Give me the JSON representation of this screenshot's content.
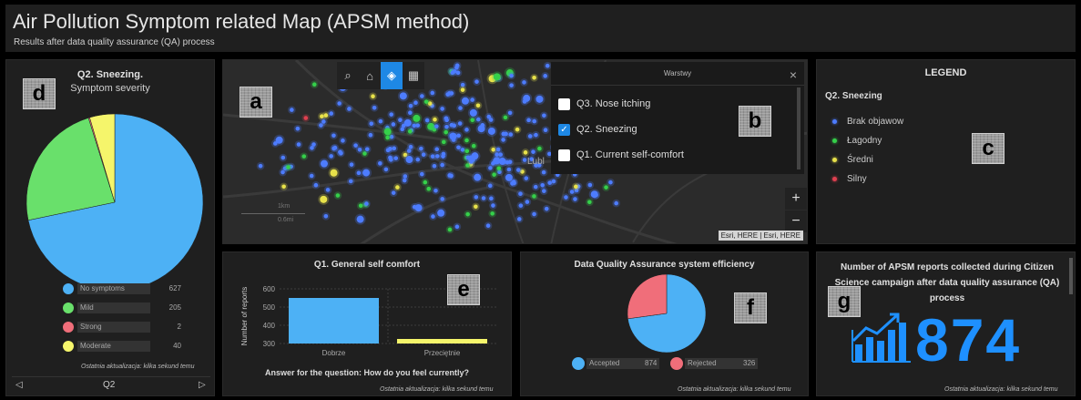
{
  "header": {
    "title": "Air Pollution Symptom related Map (APSM method)",
    "subtitle": "Results after data quality assurance (QA) process"
  },
  "tags": {
    "a": "a",
    "b": "b",
    "c": "c",
    "d": "d",
    "e": "e",
    "f": "f",
    "g": "g"
  },
  "updated_text": "Ostatnia aktualizacja: kilka sekund temu",
  "panel_d": {
    "title": "Q2. Sneezing.",
    "subtitle": "Symptom severity",
    "nav_label": "Q2",
    "nav_prev_icon": "chevron-left-icon",
    "nav_next_icon": "chevron-right-icon",
    "legend": [
      {
        "label": "No symptoms",
        "value": "627",
        "color": "#4db1f5"
      },
      {
        "label": "Mild",
        "value": "205",
        "color": "#69e06b"
      },
      {
        "label": "Strong",
        "value": "2",
        "color": "#f06e7a"
      },
      {
        "label": "Moderate",
        "value": "40",
        "color": "#f5f56b"
      }
    ]
  },
  "chart_data": [
    {
      "type": "pie",
      "title": "Q2. Sneezing.",
      "subtitle": "Symptom severity",
      "categories": [
        "No symptoms",
        "Mild",
        "Strong",
        "Moderate"
      ],
      "values": [
        627,
        205,
        2,
        40
      ],
      "colors": [
        "#4db1f5",
        "#69e06b",
        "#f06e7a",
        "#f5f56b"
      ]
    },
    {
      "type": "bar",
      "title": "Q1. General self comfort",
      "categories": [
        "Dobrze",
        "Przeciętnie"
      ],
      "values": [
        550,
        325
      ],
      "colors": [
        "#4db1f5",
        "#f5f56b"
      ],
      "xlabel": "Answer for the question: How do you feel currently?",
      "ylabel": "Number of reports",
      "ylim": [
        300,
        600
      ],
      "yticks": [
        300,
        400,
        500,
        600
      ],
      "grid": true
    },
    {
      "type": "pie",
      "title": "Data Quality Assurance system efficiency",
      "categories": [
        "Accepted",
        "Rejected"
      ],
      "values": [
        874,
        326
      ],
      "colors": [
        "#4db1f5",
        "#f06e7a"
      ]
    }
  ],
  "map": {
    "toolbar": [
      {
        "name": "search-icon",
        "glyph": "⌕"
      },
      {
        "name": "home-icon",
        "glyph": "⌂"
      },
      {
        "name": "layers-icon",
        "glyph": "◈"
      },
      {
        "name": "basemap-gallery-icon",
        "glyph": "▦"
      }
    ],
    "city_label": "Lubl",
    "scale_top": "1km",
    "scale_bottom": "0.6mi",
    "zoom_in": "+",
    "zoom_out": "−",
    "attribution": "Esri, HERE | Esri, HERE",
    "layers_panel": {
      "title": "Warstwy",
      "close": "×",
      "items": [
        {
          "label": "Q3. Nose itching",
          "checked": false
        },
        {
          "label": "Q2. Sneezing",
          "checked": true
        },
        {
          "label": "Q1. Current self-comfort",
          "checked": false
        }
      ]
    },
    "point_colors": {
      "none": "#4d7cff",
      "mild": "#35d04a",
      "moderate": "#e8e24a",
      "strong": "#e04050"
    }
  },
  "legend_panel": {
    "title": "LEGEND",
    "question": "Q2. Sneezing",
    "items": [
      {
        "label": "Brak objawow",
        "color": "#4d7cff"
      },
      {
        "label": "Łagodny",
        "color": "#35d04a"
      },
      {
        "label": "Średni",
        "color": "#e8e24a"
      },
      {
        "label": "Silny",
        "color": "#e04050"
      }
    ]
  },
  "panel_f": {
    "legend": [
      {
        "label": "Accepted",
        "value": "874",
        "color": "#4db1f5"
      },
      {
        "label": "Rejected",
        "value": "326",
        "color": "#f06e7a"
      }
    ]
  },
  "panel_g": {
    "title": "Number of APSM reports collected during Citizen Science campaign after data quality assurance (QA) process",
    "value": "874",
    "icon": "chart-growth-icon"
  }
}
